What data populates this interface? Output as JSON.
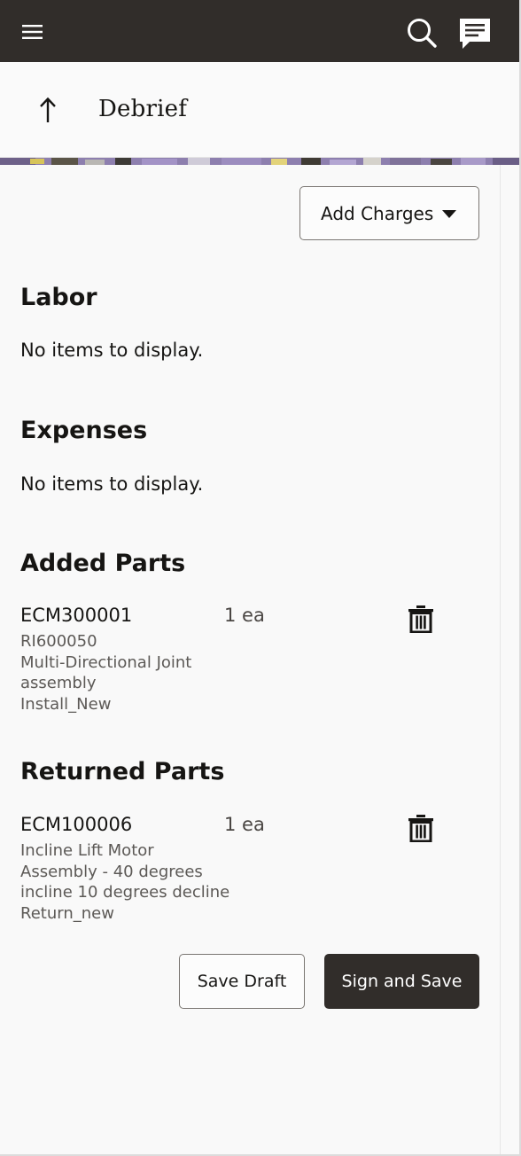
{
  "topbar": {
    "menu_icon": "hamburger-menu-icon",
    "search_icon": "search-icon",
    "chat_icon": "chat-icon"
  },
  "header": {
    "back_icon": "arrow-up-icon",
    "title": "Debrief"
  },
  "toolbar": {
    "add_charges_label": "Add Charges",
    "add_charges_icon": "caret-down-icon"
  },
  "sections": {
    "labor": {
      "title": "Labor",
      "empty_text": "No items to display."
    },
    "expenses": {
      "title": "Expenses",
      "empty_text": "No items to display."
    },
    "added_parts": {
      "title": "Added Parts",
      "items": [
        {
          "part_number": "ECM300001",
          "quantity": "1 ea",
          "details": [
            "RI600050",
            "Multi-Directional Joint",
            "assembly",
            "Install_New"
          ]
        }
      ]
    },
    "returned_parts": {
      "title": "Returned Parts",
      "items": [
        {
          "part_number": "ECM100006",
          "quantity": "1 ea",
          "details": [
            "Incline Lift Motor",
            "Assembly - 40 degrees",
            "incline 10 degrees decline",
            "Return_new"
          ]
        }
      ]
    }
  },
  "actions": {
    "save_draft_label": "Save Draft",
    "sign_and_save_label": "Sign and Save"
  },
  "colors": {
    "topbar_bg": "#312d2a",
    "primary_button_bg": "#312d2a",
    "page_bg": "#f9f9f9"
  }
}
